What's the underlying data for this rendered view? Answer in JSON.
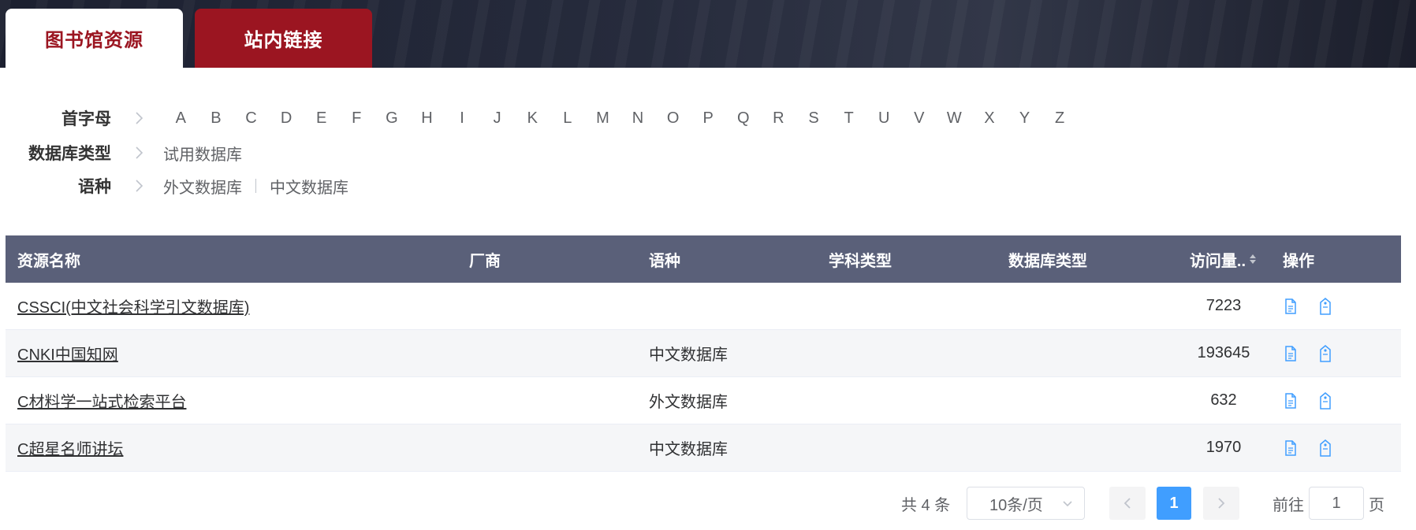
{
  "tabs": [
    {
      "label": "图书馆资源",
      "active": true
    },
    {
      "label": "站内链接",
      "active": false
    }
  ],
  "filters": {
    "initial": {
      "label": "首字母",
      "letters": [
        "A",
        "B",
        "C",
        "D",
        "E",
        "F",
        "G",
        "H",
        "I",
        "J",
        "K",
        "L",
        "M",
        "N",
        "O",
        "P",
        "Q",
        "R",
        "S",
        "T",
        "U",
        "V",
        "W",
        "X",
        "Y",
        "Z"
      ]
    },
    "db_type": {
      "label": "数据库类型",
      "options": [
        "试用数据库"
      ]
    },
    "language": {
      "label": "语种",
      "options": [
        "外文数据库",
        "中文数据库"
      ]
    }
  },
  "table": {
    "headers": [
      "资源名称",
      "厂商",
      "语种",
      "学科类型",
      "数据库类型",
      "访问量..",
      "操作"
    ],
    "rows": [
      {
        "name": "CSSCI(中文社会科学引文数据库)",
        "vendor": "",
        "language": "",
        "subject": "",
        "db_type": "",
        "visits": "7223"
      },
      {
        "name": "CNKI中国知网",
        "vendor": "",
        "language": "中文数据库",
        "subject": "",
        "db_type": "",
        "visits": "193645"
      },
      {
        "name": "C材料学一站式检索平台",
        "vendor": "",
        "language": "外文数据库",
        "subject": "",
        "db_type": "",
        "visits": "632"
      },
      {
        "name": "C超星名师讲坛",
        "vendor": "",
        "language": "中文数据库",
        "subject": "",
        "db_type": "",
        "visits": "1970"
      }
    ]
  },
  "pagination": {
    "total": "共 4 条",
    "page_size": "10条/页",
    "current_page": "1",
    "goto_label": "前往",
    "goto_value": "1",
    "goto_suffix": "页"
  },
  "colors": {
    "brand_red": "#9b1521",
    "table_header": "#5a6079",
    "icon_blue": "#409eff",
    "active_page": "#409eff"
  },
  "icons": {
    "filter_arrow": "chevron-right-icon",
    "detail": "document-icon",
    "favorite": "tag-icon",
    "sort": "sort-caret-icon",
    "prev": "chevron-left-icon",
    "next": "chevron-right-icon"
  }
}
